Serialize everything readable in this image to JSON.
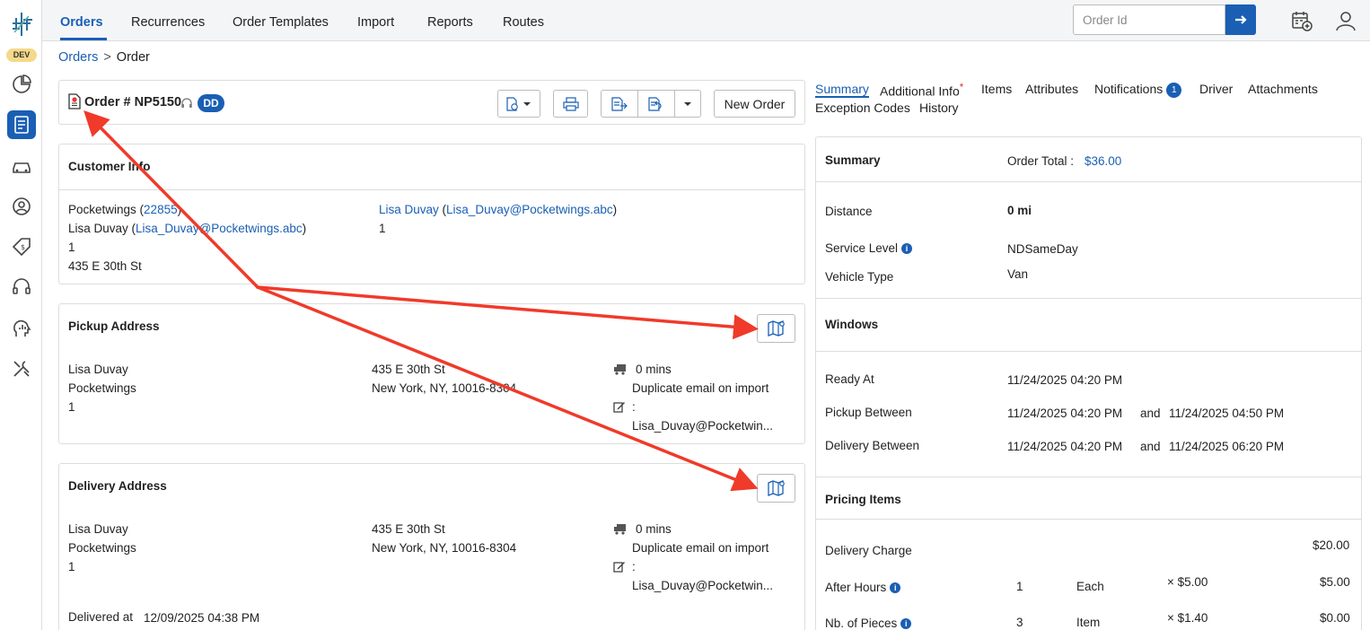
{
  "env_badge": "DEV",
  "topnav": {
    "tabs": [
      "Orders",
      "Recurrences",
      "Order Templates",
      "Import",
      "Reports",
      "Routes"
    ],
    "search_placeholder": "Order Id"
  },
  "breadcrumb": {
    "root": "Orders",
    "separator": ">",
    "current": "Order"
  },
  "order": {
    "title": "Order # NP5150",
    "badge": "DD",
    "new_order_label": "New Order"
  },
  "customer": {
    "title": "Customer Info",
    "company": "Pocketwings",
    "company_id": "22855",
    "contact_name": "Lisa Duvay",
    "contact_email": "Lisa_Duvay@Pocketwings.abc",
    "line_number": "1",
    "address": "435 E 30th St",
    "right_name": "Lisa Duvay",
    "right_email": "Lisa_Duvay@Pocketwings.abc",
    "right_number": "1"
  },
  "pickup": {
    "title": "Pickup Address",
    "name": "Lisa Duvay",
    "company": "Pocketwings",
    "number": "1",
    "street": "435 E 30th St",
    "city": "New York, NY, 10016-8304",
    "wait": "0 mins",
    "note": "Duplicate email on import",
    "note_colon": ":",
    "note_email": "Lisa_Duvay@Pocketwin..."
  },
  "delivery": {
    "title": "Delivery Address",
    "name": "Lisa Duvay",
    "company": "Pocketwings",
    "number": "1",
    "street": "435 E 30th St",
    "city": "New York, NY, 10016-8304",
    "wait": "0 mins",
    "note": "Duplicate email on import",
    "note_colon": ":",
    "note_email": "Lisa_Duvay@Pocketwin...",
    "delivered_label": "Delivered at",
    "delivered_value": "12/09/2025 04:38 PM"
  },
  "right_tabs": {
    "summary": "Summary",
    "additional_info": "Additional Info",
    "required_mark": "*",
    "items": "Items",
    "attributes": "Attributes",
    "notifications": "Notifications",
    "notifications_count": "1",
    "driver": "Driver",
    "attachments": "Attachments",
    "exception_codes": "Exception Codes",
    "history": "History"
  },
  "summary": {
    "title": "Summary",
    "order_total_label": "Order Total :",
    "order_total_value": "$36.00",
    "distance_label": "Distance",
    "distance_value": "0 mi",
    "service_level_label": "Service Level",
    "service_level_value": "NDSameDay",
    "vehicle_type_label": "Vehicle Type",
    "vehicle_type_value": "Van"
  },
  "windows": {
    "title": "Windows",
    "ready_at_label": "Ready At",
    "ready_at_value": "11/24/2025 04:20 PM",
    "pickup_between_label": "Pickup Between",
    "pickup_from": "11/24/2025 04:20 PM",
    "pickup_to": "11/24/2025 04:50 PM",
    "delivery_between_label": "Delivery Between",
    "delivery_from": "11/24/2025 04:20 PM",
    "delivery_to": "11/24/2025 06:20 PM",
    "and_label": "and"
  },
  "pricing": {
    "title": "Pricing Items",
    "rows": [
      {
        "label": "Delivery Charge",
        "qty": "",
        "unit": "",
        "rate": "",
        "amount": "$20.00"
      },
      {
        "label": "After Hours",
        "qty": "1",
        "unit": "Each",
        "rate": "× $5.00",
        "amount": "$5.00"
      },
      {
        "label": "Nb. of Pieces",
        "qty": "3",
        "unit": "Item",
        "rate": "× $1.40",
        "amount": "$0.00"
      }
    ]
  },
  "colors": {
    "accent": "#1a5fb4",
    "annotation": "#f03a2a"
  }
}
